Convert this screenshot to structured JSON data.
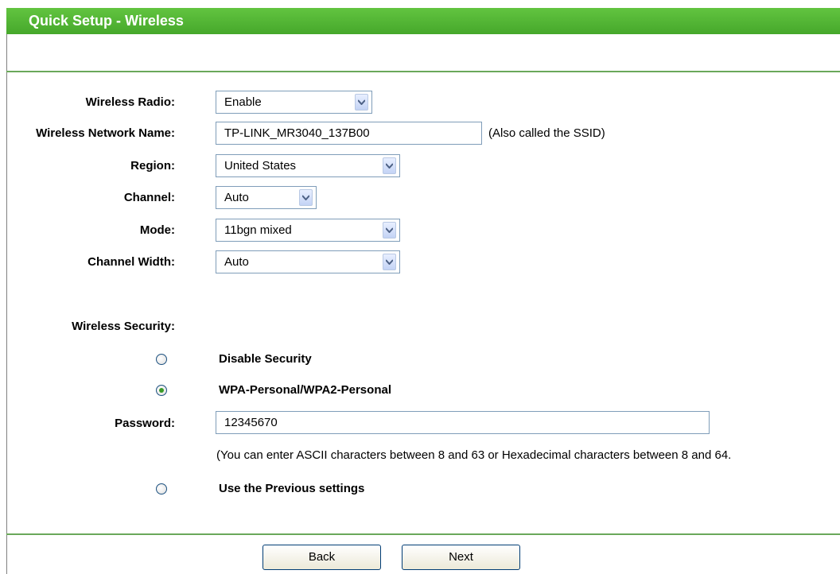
{
  "header": {
    "title": "Quick Setup - Wireless"
  },
  "form": {
    "wireless_radio": {
      "label": "Wireless Radio:",
      "value": "Enable"
    },
    "network_name": {
      "label": "Wireless Network Name:",
      "value": "TP-LINK_MR3040_137B00",
      "note": "(Also called the SSID)"
    },
    "region": {
      "label": "Region:",
      "value": "United States"
    },
    "channel": {
      "label": "Channel:",
      "value": "Auto"
    },
    "mode": {
      "label": "Mode:",
      "value": "11bgn mixed"
    },
    "channel_width": {
      "label": "Channel Width:",
      "value": "Auto"
    }
  },
  "security": {
    "label": "Wireless Security:",
    "options": [
      {
        "label": "Disable Security",
        "selected": false
      },
      {
        "label": "WPA-Personal/WPA2-Personal",
        "selected": true
      },
      {
        "label": "Use the Previous settings",
        "selected": false
      }
    ],
    "password": {
      "label": "Password:",
      "value": "12345670",
      "hint": "(You can enter ASCII characters between 8 and 63 or Hexadecimal characters between 8 and 64."
    }
  },
  "buttons": {
    "back": "Back",
    "next": "Next"
  },
  "colors": {
    "header_green": "#4cae30",
    "divider": "#6aa85a",
    "radio_selected": "#3a9a28"
  }
}
